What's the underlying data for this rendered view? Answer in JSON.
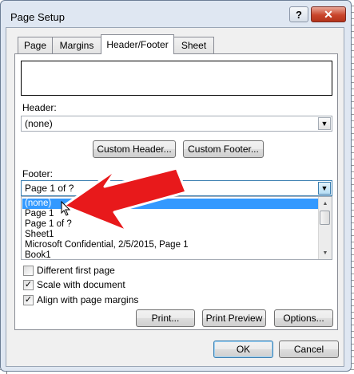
{
  "window": {
    "title": "Page Setup"
  },
  "titlebar": {
    "help_label": "?",
    "close_label": "✕"
  },
  "tabs": [
    {
      "label": "Page"
    },
    {
      "label": "Margins"
    },
    {
      "label": "Header/Footer"
    },
    {
      "label": "Sheet"
    }
  ],
  "header": {
    "label": "Header:",
    "value": "(none)"
  },
  "buttons": {
    "custom_header": "Custom Header...",
    "custom_footer": "Custom Footer...",
    "print": "Print...",
    "print_preview": "Print Preview",
    "options": "Options...",
    "ok": "OK",
    "cancel": "Cancel"
  },
  "footer": {
    "label": "Footer:",
    "value": "Page 1 of ?",
    "options": [
      "(none)",
      "Page 1",
      "Page 1 of ?",
      "Sheet1",
      "Microsoft Confidential, 2/5/2015, Page 1",
      "Book1"
    ],
    "selected_option": "(none)"
  },
  "checkboxes": [
    {
      "label": "Different first page",
      "checked": false
    },
    {
      "label": "Scale with document",
      "checked": true
    },
    {
      "label": "Align with page margins",
      "checked": true
    }
  ],
  "icons": {
    "dropdown": "chevron-down-icon",
    "scroll_up": "scroll-up-icon",
    "scroll_down": "scroll-down-icon",
    "annotation": "red-arrow-icon",
    "pointer": "mouse-cursor-icon"
  },
  "colors": {
    "selection": "#3399ff",
    "annotation_arrow": "#e8191b",
    "close_button": "#c9452c"
  }
}
